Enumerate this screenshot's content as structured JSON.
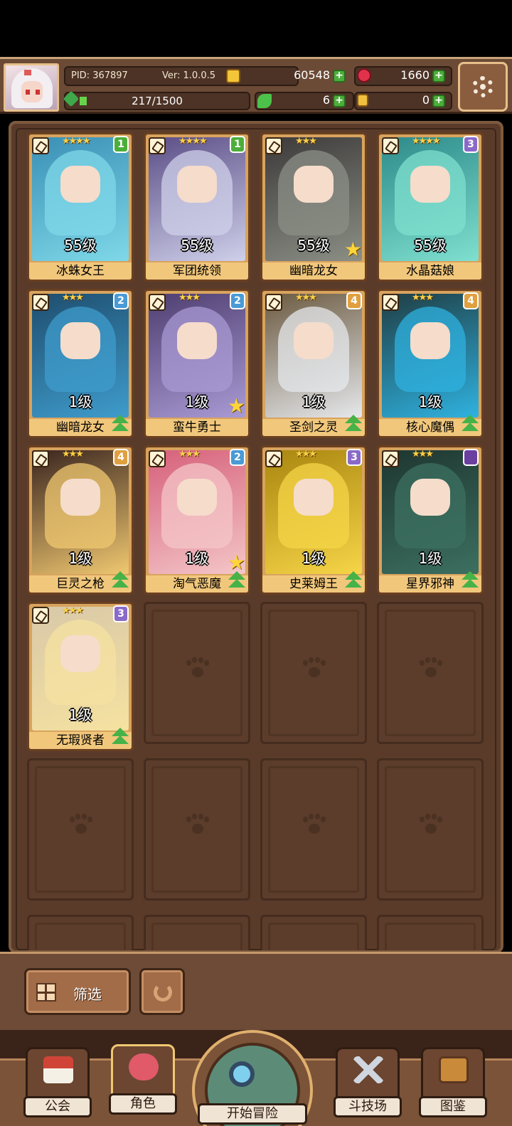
{
  "player": {
    "pid": "PID: 367897",
    "version": "Ver: 1.0.0.5",
    "xp": "217/1500",
    "xp_progress": 0.1447
  },
  "currency": {
    "gold": "60548",
    "gems": "1660",
    "clover": "6",
    "keys": "0"
  },
  "heroes": [
    {
      "name": "冰蛛女王",
      "level": "55级",
      "stars": "★★★★",
      "badge": "1",
      "badge_color": "#4cae3a",
      "colors": [
        "#3a8fb5",
        "#7fd8e8"
      ],
      "upgrade": false,
      "star_mark": false
    },
    {
      "name": "军团统领",
      "level": "55级",
      "stars": "★★★★",
      "badge": "1",
      "badge_color": "#4cae3a",
      "colors": [
        "#5b4e86",
        "#cfd0ea"
      ],
      "upgrade": false,
      "star_mark": false
    },
    {
      "name": "幽暗龙女",
      "level": "55级",
      "stars": "★★★",
      "badge": "",
      "badge_color": "",
      "colors": [
        "#3d3a3a",
        "#8b8f85"
      ],
      "upgrade": false,
      "star_mark": true
    },
    {
      "name": "水晶菇娘",
      "level": "55级",
      "stars": "★★★★",
      "badge": "3",
      "badge_color": "#8a6ac8",
      "colors": [
        "#2d8a8a",
        "#7fe0cf"
      ],
      "upgrade": false,
      "star_mark": false
    },
    {
      "name": "幽暗龙女",
      "level": "1级",
      "stars": "★★★",
      "badge": "2",
      "badge_color": "#4a9ad6",
      "colors": [
        "#1e4d6e",
        "#3f9ccc"
      ],
      "upgrade": true,
      "star_mark": false
    },
    {
      "name": "蛮牛勇士",
      "level": "1级",
      "stars": "★★★",
      "badge": "2",
      "badge_color": "#4a9ad6",
      "colors": [
        "#4e3e70",
        "#a99ad4"
      ],
      "upgrade": false,
      "star_mark": true
    },
    {
      "name": "圣剑之灵",
      "level": "1级",
      "stars": "★★★",
      "badge": "4",
      "badge_color": "#e0a040",
      "colors": [
        "#6b5a40",
        "#e6e8ec"
      ],
      "upgrade": true,
      "star_mark": false
    },
    {
      "name": "核心魔偶",
      "level": "1级",
      "stars": "★★★",
      "badge": "4",
      "badge_color": "#e0a040",
      "colors": [
        "#1f3e44",
        "#2fb2e0"
      ],
      "upgrade": true,
      "star_mark": false
    },
    {
      "name": "巨灵之枪",
      "level": "1级",
      "stars": "★★★",
      "badge": "4",
      "badge_color": "#e0a040",
      "colors": [
        "#3a2520",
        "#f0c870"
      ],
      "upgrade": true,
      "star_mark": false
    },
    {
      "name": "淘气恶魔",
      "level": "1级",
      "stars": "★★★",
      "badge": "2",
      "badge_color": "#4a9ad6",
      "colors": [
        "#d6607a",
        "#f4c6c8"
      ],
      "upgrade": true,
      "star_mark": true
    },
    {
      "name": "史莱姆王",
      "level": "1级",
      "stars": "★★★",
      "badge": "3",
      "badge_color": "#8a6ac8",
      "colors": [
        "#a9860f",
        "#f6d548"
      ],
      "upgrade": true,
      "star_mark": false
    },
    {
      "name": "星界邪神",
      "level": "1级",
      "stars": "★★★",
      "badge": "",
      "badge_color": "#6a3fa0",
      "colors": [
        "#1e3630",
        "#3c7060"
      ],
      "upgrade": true,
      "star_mark": false
    },
    {
      "name": "无瑕贤者",
      "level": "1级",
      "stars": "★★★",
      "badge": "3",
      "badge_color": "#8a6ac8",
      "colors": [
        "#d8c8a8",
        "#f6e2a0"
      ],
      "upgrade": true,
      "star_mark": false
    }
  ],
  "controls": {
    "filter_label": "筛选"
  },
  "nav": {
    "guild": "公会",
    "roles": "角色",
    "start": "开始冒险",
    "arena": "斗技场",
    "codex": "图鉴"
  }
}
